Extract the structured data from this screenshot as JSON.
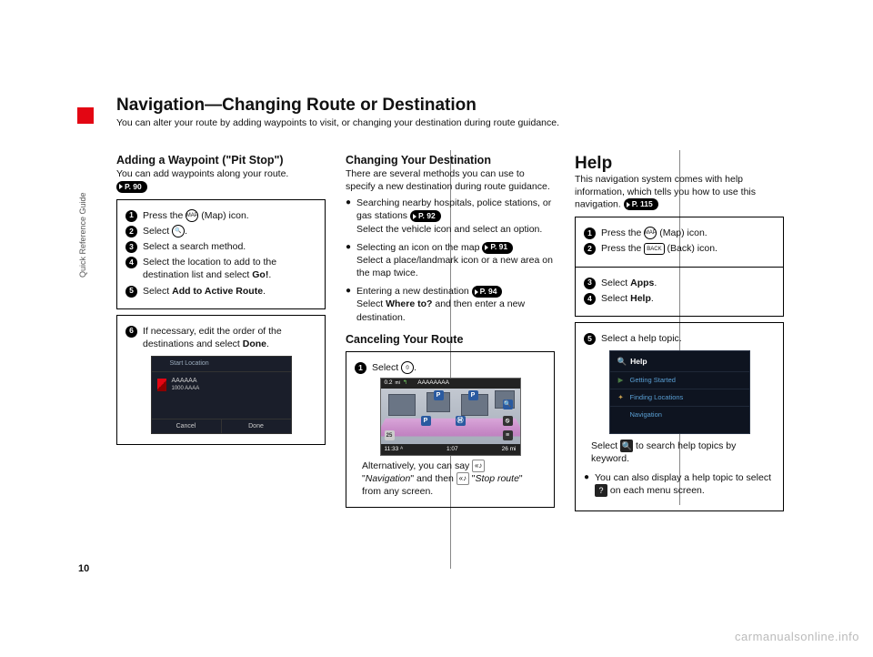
{
  "side_label": "Quick Reference Guide",
  "page_number": "10",
  "watermark": "carmanualsonline.info",
  "title": "Navigation—Changing Route or Destination",
  "subtitle": "You can alter your route by adding waypoints to visit, or changing your destination during route guidance.",
  "col1": {
    "heading": "Adding a Waypoint (\"Pit Stop\")",
    "intro": "You can add waypoints along your route.",
    "pref": "P. 90",
    "steps_box1": {
      "s1_a": "Press the ",
      "s1_icon": "MAP",
      "s1_b": " (Map) icon.",
      "s2_a": "Select ",
      "s2_icon": "🔍",
      "s2_b": ".",
      "s3": "Select a search method.",
      "s4_a": "Select the location to add to the destination list and select ",
      "s4_b": "Go!",
      "s4_c": ".",
      "s5_a": "Select ",
      "s5_b": "Add to Active Route",
      "s5_c": "."
    },
    "steps_box2": {
      "s6_a": "If necessary, edit the order of the destinations and select ",
      "s6_b": "Done",
      "s6_c": "."
    },
    "shot": {
      "start": "Start Location",
      "line1": "AAAAAA",
      "line2": "1000 AAAA",
      "cancel": "Cancel",
      "done": "Done"
    }
  },
  "col2": {
    "heading": "Changing Your Destination",
    "intro": "There are several methods you can use to specify a new destination during route guidance.",
    "b1_a": "Searching nearby hospitals, police stations, or gas stations ",
    "b1_pref": "P. 92",
    "b1_b": "Select the vehicle icon and select an option.",
    "b2_a": "Selecting an icon on the map ",
    "b2_pref": "P. 91",
    "b2_b": "Select a place/landmark icon or a new area on the map twice.",
    "b3_a": "Entering a new destination ",
    "b3_pref": "P. 94",
    "b3_b1": "Select ",
    "b3_b2": "Where to?",
    "b3_b3": " and then enter a new destination.",
    "heading2": "Canceling Your Route",
    "cancel_box": {
      "s1_a": "Select ",
      "s1_icon": "⦸",
      "s1_b": ".",
      "alt_a": "Alternatively, you can say ",
      "alt_b": " \"",
      "alt_c": "Navigation",
      "alt_d": "\" and then ",
      "alt_e": " \"",
      "alt_f": "Stop route",
      "alt_g": "\" from any screen."
    },
    "map": {
      "dist": "0.2",
      "unit": "mi",
      "street": "AAAAAAAA",
      "time": "11:33",
      "arrive": "1:07",
      "remain": "26"
    }
  },
  "col3": {
    "heading": "Help",
    "intro": "This navigation system comes with help information, which tells you how to use this navigation. ",
    "pref": "P. 115",
    "box1": {
      "s1_a": "Press the ",
      "s1_icon": "MAP",
      "s1_b": " (Map) icon.",
      "s2_a": "Press the ",
      "s2_icon": "BACK",
      "s2_b": " (Back) icon."
    },
    "box2": {
      "s3_a": "Select ",
      "s3_b": "Apps",
      "s3_c": ".",
      "s4_a": "Select ",
      "s4_b": "Help",
      "s4_c": "."
    },
    "box3": {
      "s5": "Select a help topic.",
      "after_a": "Select ",
      "after_b": " to search help topics by keyword.",
      "bullet_a": "You can also display a help topic to select ",
      "bullet_b": " on each menu screen."
    },
    "shot": {
      "title": "Help",
      "i1": "Getting Started",
      "i2": "Finding Locations",
      "i3": "Navigation"
    }
  }
}
